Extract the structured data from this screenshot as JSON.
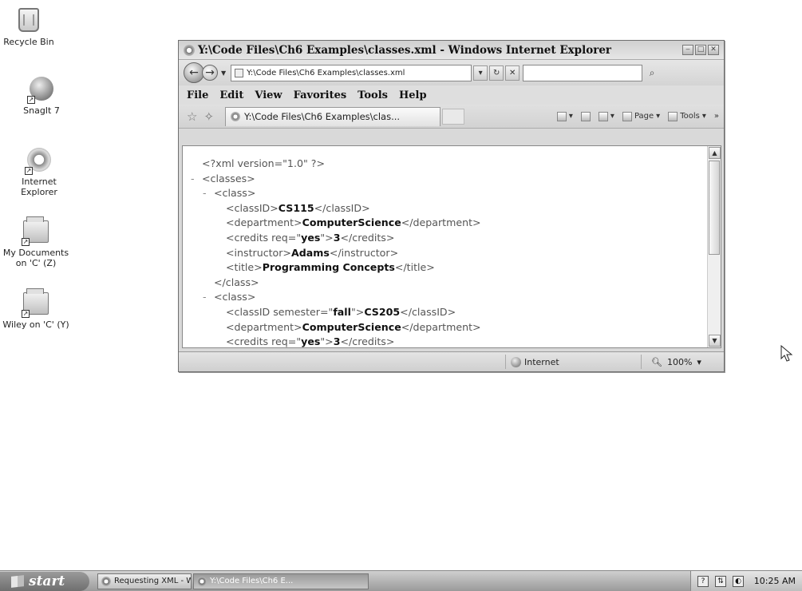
{
  "desktop": {
    "icons": [
      {
        "label": "Recycle Bin",
        "icon": "recycle-bin-icon"
      },
      {
        "label": "SnagIt 7",
        "icon": "snagit-icon"
      },
      {
        "label": "Internet\nExplorer",
        "icon": "internet-explorer-icon"
      },
      {
        "label": "My Documents\non 'C' (Z)",
        "icon": "network-drive-icon"
      },
      {
        "label": "Wiley on 'C' (Y)",
        "icon": "network-drive-icon"
      }
    ]
  },
  "window": {
    "title": "Y:\\Code Files\\Ch6 Examples\\classes.xml - Windows Internet Explorer",
    "address": "Y:\\Code Files\\Ch6 Examples\\classes.xml",
    "search_placeholder": "",
    "menu": [
      "File",
      "Edit",
      "View",
      "Favorites",
      "Tools",
      "Help"
    ],
    "tab_label": "Y:\\Code Files\\Ch6 Examples\\clas...",
    "commands": {
      "page": "Page",
      "tools": "Tools"
    },
    "status": {
      "zone": "Internet",
      "zoom": "100%"
    }
  },
  "xml_view": {
    "lines": [
      {
        "indent": 0,
        "minus": false,
        "parts": [
          {
            "t": "<?xml version=\"1.0\" ?>"
          }
        ]
      },
      {
        "indent": 0,
        "minus": true,
        "parts": [
          {
            "t": "<classes>"
          }
        ]
      },
      {
        "indent": 1,
        "minus": true,
        "parts": [
          {
            "t": "<class>"
          }
        ]
      },
      {
        "indent": 2,
        "minus": false,
        "parts": [
          {
            "t": "<classID>"
          },
          {
            "b": "CS115"
          },
          {
            "t": "</classID>"
          }
        ]
      },
      {
        "indent": 2,
        "minus": false,
        "parts": [
          {
            "t": "<department>"
          },
          {
            "b": "ComputerScience"
          },
          {
            "t": "</department>"
          }
        ]
      },
      {
        "indent": 2,
        "minus": false,
        "parts": [
          {
            "t": "<credits req=\""
          },
          {
            "b": "yes"
          },
          {
            "t": "\">"
          },
          {
            "b": "3"
          },
          {
            "t": "</credits>"
          }
        ]
      },
      {
        "indent": 2,
        "minus": false,
        "parts": [
          {
            "t": "<instructor>"
          },
          {
            "b": "Adams"
          },
          {
            "t": "</instructor>"
          }
        ]
      },
      {
        "indent": 2,
        "minus": false,
        "parts": [
          {
            "t": "<title>"
          },
          {
            "b": "Programming Concepts"
          },
          {
            "t": "</title>"
          }
        ]
      },
      {
        "indent": 1,
        "minus": false,
        "parts": [
          {
            "t": "</class>"
          }
        ]
      },
      {
        "indent": 1,
        "minus": true,
        "parts": [
          {
            "t": "<class>"
          }
        ]
      },
      {
        "indent": 2,
        "minus": false,
        "parts": [
          {
            "t": "<classID semester=\""
          },
          {
            "b": "fall"
          },
          {
            "t": "\">"
          },
          {
            "b": "CS205"
          },
          {
            "t": "</classID>"
          }
        ]
      },
      {
        "indent": 2,
        "minus": false,
        "parts": [
          {
            "t": "<department>"
          },
          {
            "b": "ComputerScience"
          },
          {
            "t": "</department>"
          }
        ]
      },
      {
        "indent": 2,
        "minus": false,
        "parts": [
          {
            "t": "<credits req=\""
          },
          {
            "b": "yes"
          },
          {
            "t": "\">"
          },
          {
            "b": "3"
          },
          {
            "t": "</credits>"
          }
        ]
      }
    ]
  },
  "taskbar": {
    "start_label": "start",
    "tasks": [
      "Requesting XML - Win...",
      "Y:\\Code Files\\Ch6 E..."
    ],
    "clock": "10:25 AM"
  }
}
